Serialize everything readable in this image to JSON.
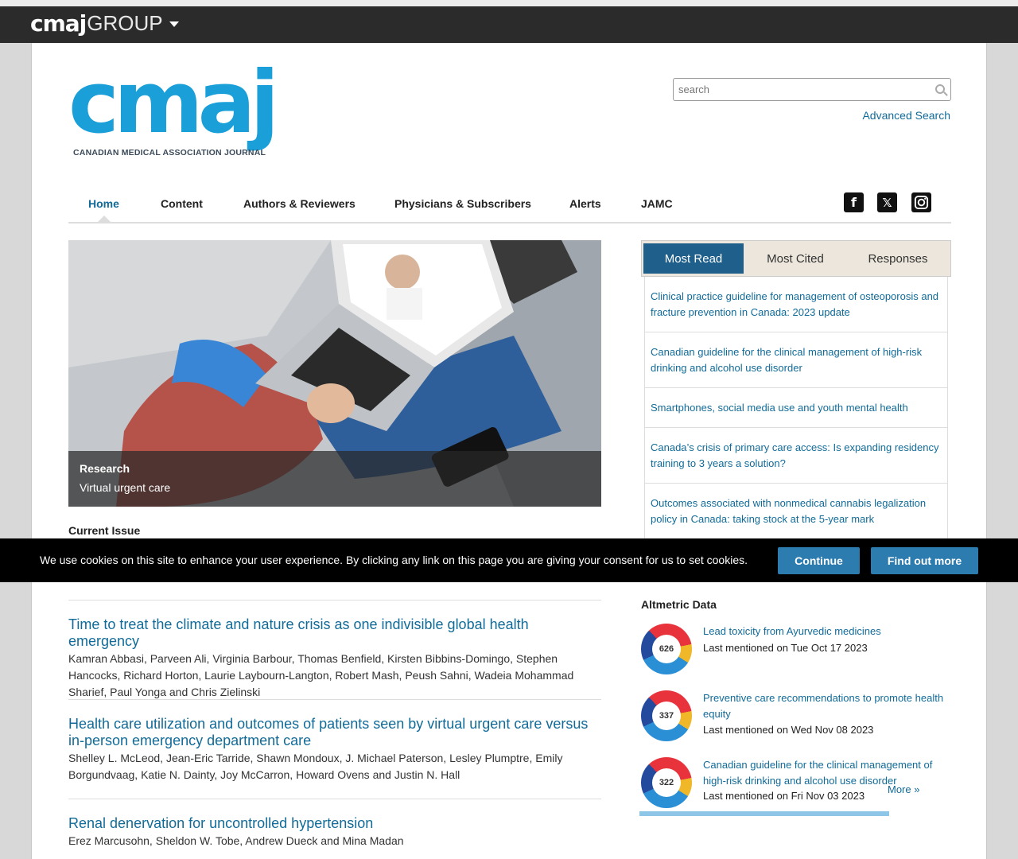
{
  "group_bar": {
    "brand_bold": "cmaj",
    "brand_light": "GROUP"
  },
  "logo": {
    "name": "cmaj",
    "subtitle": "CANADIAN MEDICAL ASSOCIATION JOURNAL"
  },
  "search": {
    "placeholder": "search",
    "advanced_label": "Advanced Search"
  },
  "nav": {
    "items": [
      "Home",
      "Content",
      "Authors & Reviewers",
      "Physicians & Subscribers",
      "Alerts",
      "JAMC"
    ],
    "active": "Home",
    "social": [
      "facebook-icon",
      "x-icon",
      "instagram-icon"
    ]
  },
  "hero": {
    "section": "Research",
    "title": "Virtual urgent care"
  },
  "current_issue_label": "Current Issue",
  "tabs": {
    "items": [
      "Most Read",
      "Most Cited",
      "Responses"
    ],
    "active": "Most Read"
  },
  "most_read": [
    "Clinical practice guideline for management of osteoporosis and fracture prevention in Canada: 2023 update",
    "Canadian guideline for the clinical management of high-risk drinking and alcohol use disorder",
    "Smartphones, social media use and youth mental health",
    "Canada’s crisis of primary care access: Is expanding residency training to 3 years a solution?",
    "Outcomes associated with nonmedical cannabis legalization policy in Canada: taking stock at the 5-year mark"
  ],
  "cookie": {
    "message": "We use cookies on this site to enhance your user experience. By clicking any link on this page you are giving your consent for us to set cookies.",
    "continue_label": "Continue",
    "find_out_label": "Find out more"
  },
  "articles": [
    {
      "title": "Time to treat the climate and nature crisis as one indivisible global health emergency",
      "authors": "Kamran Abbasi, Parveen Ali, Virginia Barbour, Thomas Benfield, Kirsten Bibbins-Domingo, Stephen Hancocks, Richard Horton, Laurie Laybourn-Langton, Robert Mash, Peush Sahni, Wadeia Mohammad Sharief, Paul Yonga and Chris Zielinski"
    },
    {
      "title": "Health care utilization and outcomes of patients seen by virtual urgent care versus in-person emergency department care",
      "authors": "Shelley L. McLeod, Jean-Eric Tarride, Shawn Mondoux, J. Michael Paterson, Lesley Plumptre, Emily Borgundvaag, Katie N. Dainty, Joy McCarron, Howard Ovens and Justin N. Hall"
    },
    {
      "title": "Renal denervation for uncontrolled hypertension",
      "authors": "Erez Marcusohn, Sheldon W. Tobe, Andrew Dueck and Mina Madan"
    }
  ],
  "altmetric": {
    "heading": "Altmetric Data",
    "items": [
      {
        "score": "626",
        "title": "Lead toxicity from Ayurvedic medicines",
        "last": "Last mentioned on Tue Oct 17 2023"
      },
      {
        "score": "337",
        "title": "Preventive care recommendations to promote health equity",
        "last": "Last mentioned on Wed Nov 08 2023"
      },
      {
        "score": "322",
        "title": "Canadian guideline for the clinical management of high-risk drinking and alcohol use disorder",
        "last": "Last mentioned on Fri Nov 03 2023"
      }
    ],
    "more_label": "More »"
  },
  "colors": {
    "brand": "#1a9fd8",
    "link": "#116b98",
    "tab_active": "#1f5f8b",
    "cookie_button": "#2d7cb0"
  }
}
